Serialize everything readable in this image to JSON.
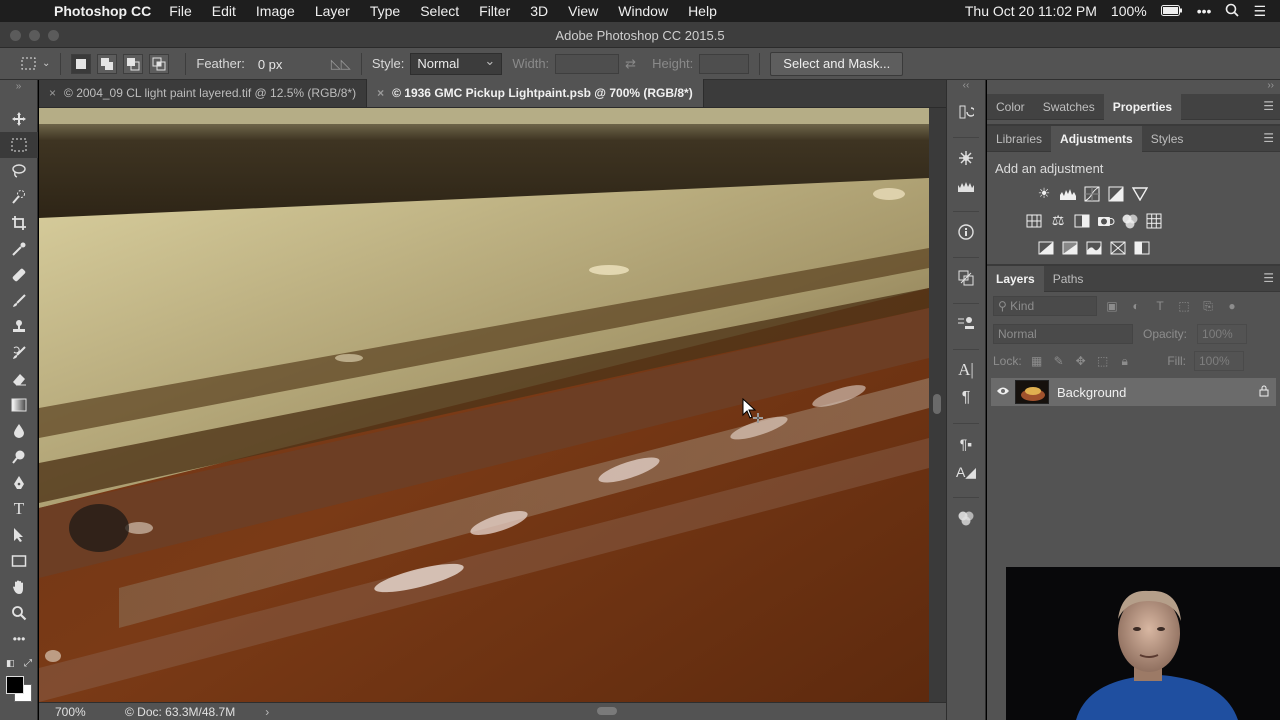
{
  "menubar": {
    "app_name": "Photoshop CC",
    "items": [
      "File",
      "Edit",
      "Image",
      "Layer",
      "Type",
      "Select",
      "Filter",
      "3D",
      "View",
      "Window",
      "Help"
    ],
    "datetime": "Thu Oct 20  11:02 PM",
    "battery": "100%"
  },
  "window": {
    "title": "Adobe Photoshop CC 2015.5"
  },
  "options": {
    "feather_label": "Feather:",
    "feather_value": "0 px",
    "style_label": "Style:",
    "style_value": "Normal",
    "width_label": "Width:",
    "height_label": "Height:",
    "select_mask": "Select and Mask..."
  },
  "tabs": [
    {
      "label": "© 2004_09 CL light paint layered.tif @ 12.5% (RGB/8*)"
    },
    {
      "label": "© 1936 GMC Pickup Lightpaint.psb @ 700% (RGB/8*)"
    }
  ],
  "status": {
    "zoom": "700%",
    "doc": "© Doc: 63.3M/48.7M"
  },
  "panels": {
    "top_tabs": [
      "Color",
      "Swatches",
      "Properties"
    ],
    "mid_tabs": [
      "Libraries",
      "Adjustments",
      "Styles"
    ],
    "add_adjustment": "Add an adjustment",
    "layer_tabs": [
      "Layers",
      "Paths"
    ],
    "kind_placeholder": "Kind",
    "blend_mode": "Normal",
    "opacity_label": "Opacity:",
    "opacity_value": "100%",
    "lock_label": "Lock:",
    "fill_label": "Fill:",
    "fill_value": "100%",
    "layer_name": "Background"
  },
  "colors": {
    "panel_bg": "#535353",
    "dark_bg": "#3b3b3b",
    "foreground": "#000000",
    "background": "#ffffff"
  }
}
